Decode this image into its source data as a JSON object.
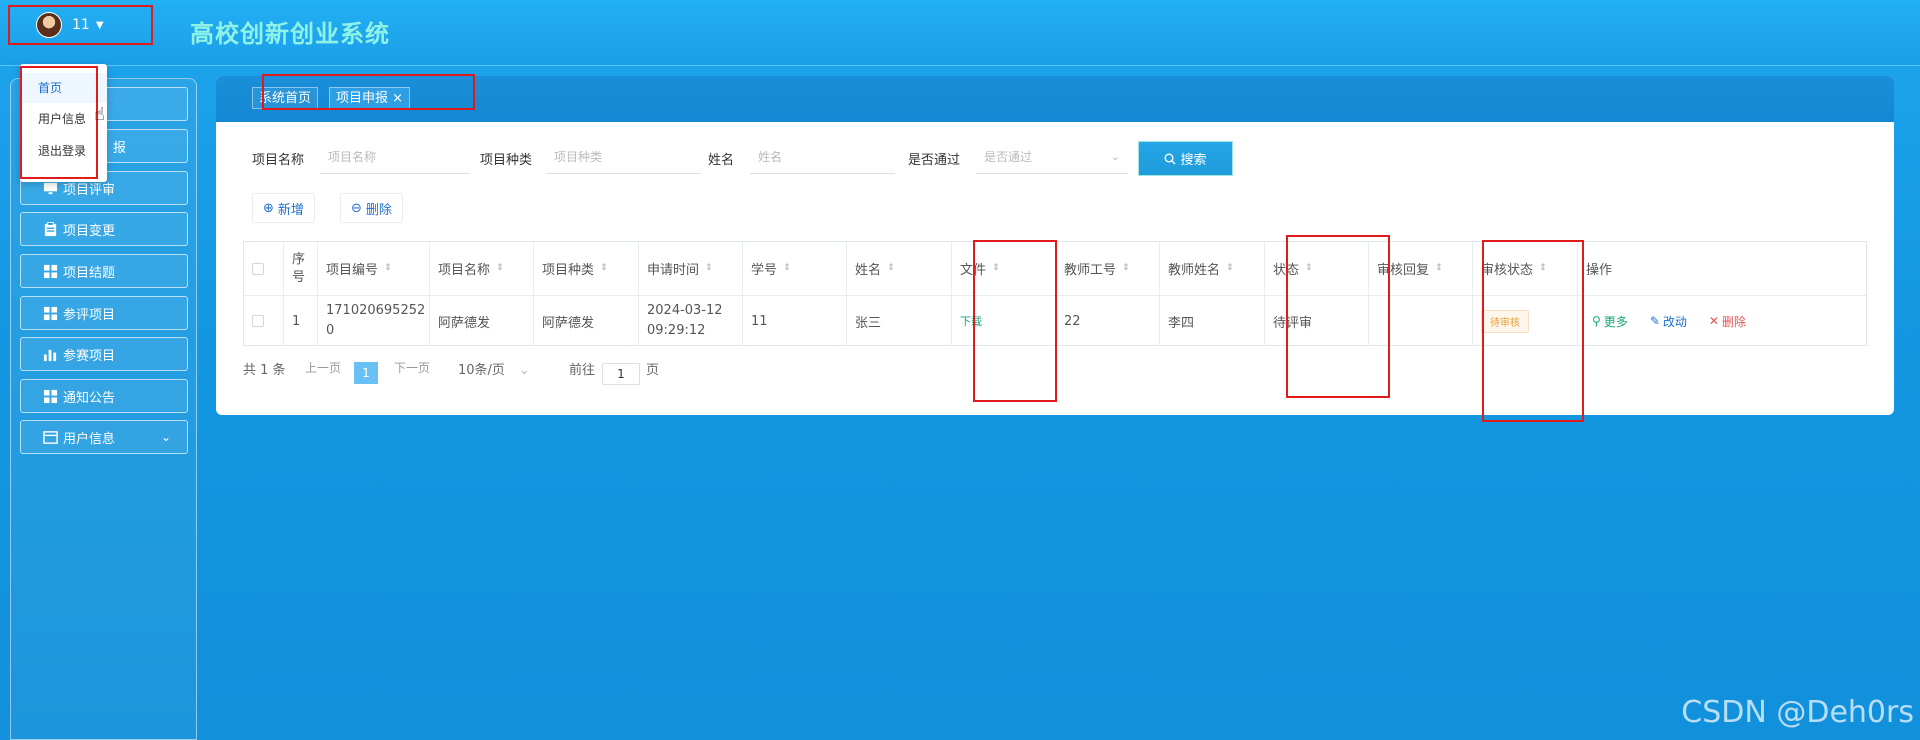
{
  "header": {
    "app_title": "高校创新创业系统",
    "user_name": "11"
  },
  "user_menu": {
    "items": [
      "首页",
      "用户信息",
      "退出登录"
    ]
  },
  "sidebar": {
    "items": [
      {
        "label": "",
        "icon": "home-icon"
      },
      {
        "label": "报",
        "icon": "document-icon"
      },
      {
        "label": "项目评审",
        "icon": "monitor-icon"
      },
      {
        "label": "项目变更",
        "icon": "clipboard-icon"
      },
      {
        "label": "项目结题",
        "icon": "grid-icon"
      },
      {
        "label": "参评项目",
        "icon": "grid-icon"
      },
      {
        "label": "参赛项目",
        "icon": "bar-chart-icon"
      },
      {
        "label": "通知公告",
        "icon": "grid-icon"
      },
      {
        "label": "用户信息",
        "icon": "id-card-icon"
      }
    ]
  },
  "tabs": [
    {
      "label": "系统首页"
    },
    {
      "label": "项目申报",
      "close": "×"
    }
  ],
  "search": {
    "fields": [
      {
        "label": "项目名称",
        "placeholder": "项目名称"
      },
      {
        "label": "项目种类",
        "placeholder": "项目种类"
      },
      {
        "label": "姓名",
        "placeholder": "姓名"
      },
      {
        "label": "是否通过",
        "placeholder": "是否通过"
      }
    ],
    "button": "搜索"
  },
  "toolbar": {
    "add": "新增",
    "delete": "删除"
  },
  "table": {
    "headers": [
      "序号",
      "项目编号",
      "项目名称",
      "项目种类",
      "申请时间",
      "学号",
      "姓名",
      "文件",
      "教师工号",
      "教师姓名",
      "状态",
      "审核回复",
      "审核状态",
      "操作"
    ],
    "row": {
      "index": "1",
      "project_no": "1710206952520",
      "project_name": "阿萨德发",
      "project_type": "阿萨德发",
      "apply_time": "2024-03-12 09:29:12",
      "student_no": "11",
      "name": "张三",
      "file": "下载",
      "teacher_no": "22",
      "teacher_name": "李四",
      "status": "待评审",
      "reply": "",
      "audit_status": "待审核",
      "actions": [
        "更多",
        "改动",
        "删除"
      ]
    }
  },
  "pagination": {
    "total": "共 1 条",
    "prev": "上一页",
    "current": "1",
    "next": "下一页",
    "page_size": "10条/页",
    "goto": "前往",
    "goto_value": "1",
    "page_suffix": "页"
  },
  "watermark": "CSDN @Deh0rs"
}
